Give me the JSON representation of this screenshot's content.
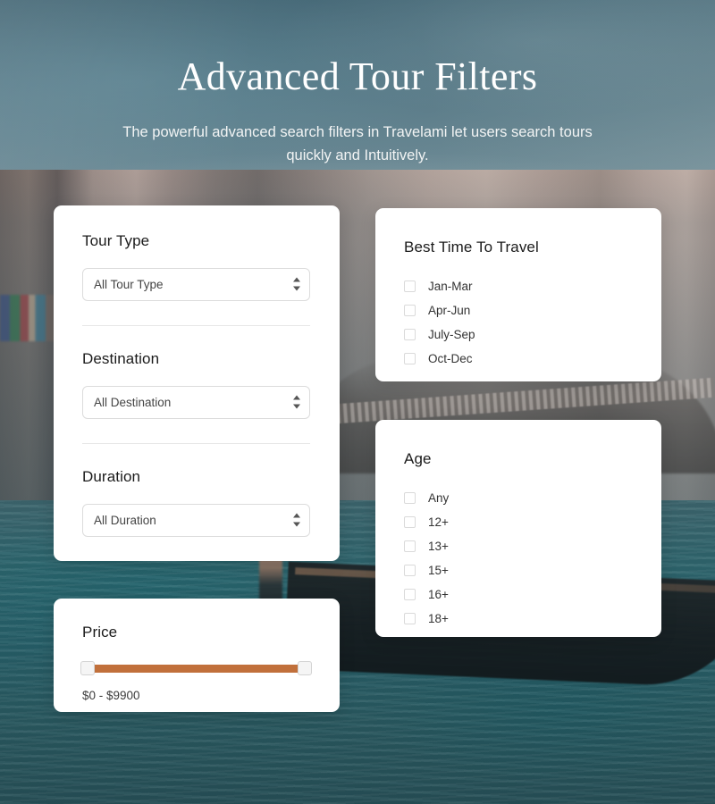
{
  "hero": {
    "title": "Advanced Tour Filters",
    "subtitle": "The powerful advanced search filters in Travelami let users search tours quickly and Intuitively."
  },
  "theme": {
    "accent": "#c1703b",
    "card_bg": "#ffffff",
    "title_color": "#ffffff",
    "border": "#dcdcdc"
  },
  "filters": {
    "tour_type": {
      "label": "Tour Type",
      "select_value": "All Tour Type"
    },
    "destination": {
      "label": "Destination",
      "select_value": "All Destination"
    },
    "duration": {
      "label": "Duration",
      "select_value": "All Duration"
    },
    "price": {
      "label": "Price",
      "range_text": "$0 - $9900",
      "min": 0,
      "max": 9900
    },
    "best_time": {
      "label": "Best Time To Travel",
      "options": [
        {
          "label": "Jan-Mar",
          "checked": false
        },
        {
          "label": "Apr-Jun",
          "checked": false
        },
        {
          "label": "July-Sep",
          "checked": false
        },
        {
          "label": "Oct-Dec",
          "checked": false
        }
      ]
    },
    "age": {
      "label": "Age",
      "options": [
        {
          "label": "Any",
          "checked": false
        },
        {
          "label": "12+",
          "checked": false
        },
        {
          "label": "13+",
          "checked": false
        },
        {
          "label": "15+",
          "checked": false
        },
        {
          "label": "16+",
          "checked": false
        },
        {
          "label": "18+",
          "checked": false
        }
      ]
    }
  }
}
